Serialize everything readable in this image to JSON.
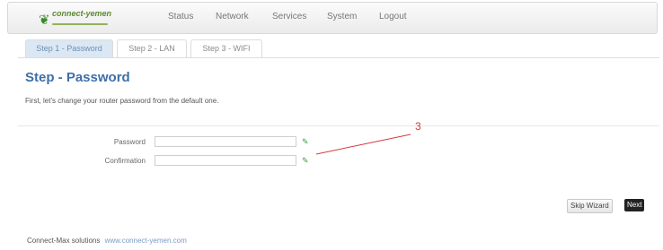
{
  "header": {
    "logo_text": "connect-yemen",
    "nav": [
      "Status",
      "Network",
      "Services",
      "System",
      "Logout"
    ]
  },
  "wizard": {
    "tabs": [
      "Step 1 - Password",
      "Step 2 - LAN",
      "Step 3 - WIFI"
    ],
    "title": "Step - Password",
    "description": "First, let's change your router password from the default one.",
    "fields": [
      {
        "label": "Password",
        "value": ""
      },
      {
        "label": "Confirmation",
        "value": ""
      }
    ],
    "annotation": "3",
    "skip_label": "Skip Wizard",
    "next_label": "Next"
  },
  "footer": {
    "text": "Connect-Max solutions",
    "link": "www.connect-yemen.com"
  },
  "colors": {
    "title": "#3d6fa8",
    "active_tab_bg": "#dbe8f4",
    "next_button": "#222222",
    "annotation": "#d43a3a",
    "password_icon": "#3f9a3f"
  }
}
